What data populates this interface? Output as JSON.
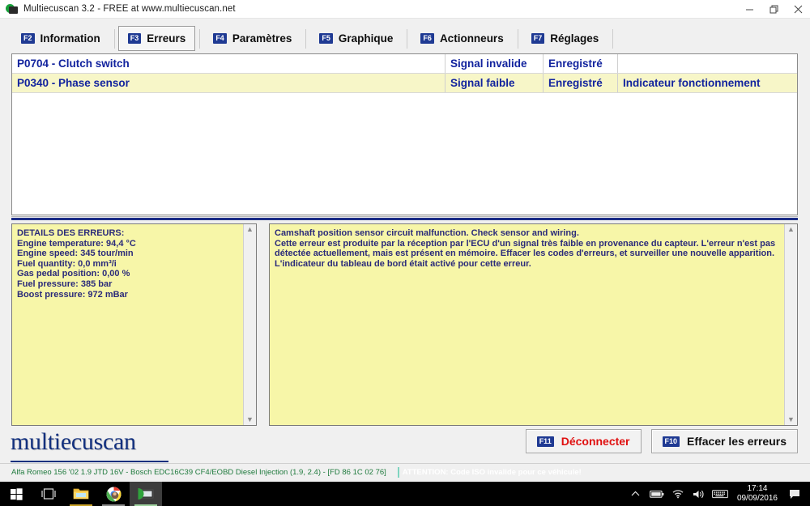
{
  "window": {
    "title": "Multiecuscan 3.2 - FREE at www.multiecuscan.net",
    "icon": "multiecuscan-app-icon",
    "minimize_label": "minimize-icon",
    "restore_label": "restore-icon",
    "close_label": "close-icon"
  },
  "tabs": [
    {
      "fkey": "F2",
      "label": "Information",
      "active": false
    },
    {
      "fkey": "F3",
      "label": "Erreurs",
      "active": true
    },
    {
      "fkey": "F4",
      "label": "Paramètres",
      "active": false
    },
    {
      "fkey": "F5",
      "label": "Graphique",
      "active": false
    },
    {
      "fkey": "F6",
      "label": "Actionneurs",
      "active": false
    },
    {
      "fkey": "F7",
      "label": "Réglages",
      "active": false
    }
  ],
  "error_table": {
    "rows": [
      {
        "code": "P0704 - Clutch switch",
        "status": "Signal invalide",
        "state": "Enregistré",
        "extra": ""
      },
      {
        "code": "P0340 - Phase sensor",
        "status": "Signal faible",
        "state": "Enregistré",
        "extra": "Indicateur fonctionnement"
      }
    ]
  },
  "details_panel": {
    "title": "DETAILS DES ERREURS:",
    "lines": [
      "Engine temperature: 94,4 °C",
      "Engine speed: 345 tour/min",
      "Fuel quantity: 0,0 mm³/i",
      "Gas pedal position: 0,00 %",
      "Fuel pressure: 385 bar",
      "Boost pressure: 972 mBar"
    ]
  },
  "description_panel": {
    "lines": [
      "Camshaft position sensor circuit malfunction. Check sensor and wiring.",
      "Cette erreur est produite par la réception par l'ECU d'un signal très faible en provenance du capteur. L'erreur n'est pas détectée actuellement, mais est présent en mémoire. Effacer les codes d'erreurs, et surveiller une nouvelle apparition.",
      "L'indicateur du tableau de bord était activé pour cette erreur."
    ]
  },
  "footer": {
    "logo": "multiecuscan",
    "buttons": [
      {
        "fkey": "F11",
        "label": "Déconnecter",
        "color": "#e01010"
      },
      {
        "fkey": "F10",
        "label": "Effacer les erreurs",
        "color": "#111111"
      }
    ]
  },
  "statusbar": {
    "vehicle": "Alfa Romeo 156 '02 1.9 JTD 16V - Bosch EDC16C39 CF4/EOBD Diesel Injection (1.9, 2.4) - [FD 86 1C 02 76]",
    "warning": "ATTENTION: Code ISO invalide pour ce véhicule!"
  },
  "taskbar": {
    "items": [
      {
        "name": "start-button",
        "icon": "windows-logo-icon"
      },
      {
        "name": "task-view-button",
        "icon": "task-view-icon"
      },
      {
        "name": "file-explorer-button",
        "icon": "folder-icon"
      },
      {
        "name": "chrome-button",
        "icon": "chrome-icon"
      },
      {
        "name": "multiecuscan-button",
        "icon": "multiecuscan-icon"
      }
    ],
    "tray": {
      "chevron": "show-hidden-icons",
      "battery": "battery-icon",
      "wifi": "wifi-icon",
      "volume": "volume-icon",
      "keyboard": "keyboard-icon",
      "action_center": "action-center-icon"
    },
    "time": "17:14",
    "date": "09/09/2016"
  }
}
